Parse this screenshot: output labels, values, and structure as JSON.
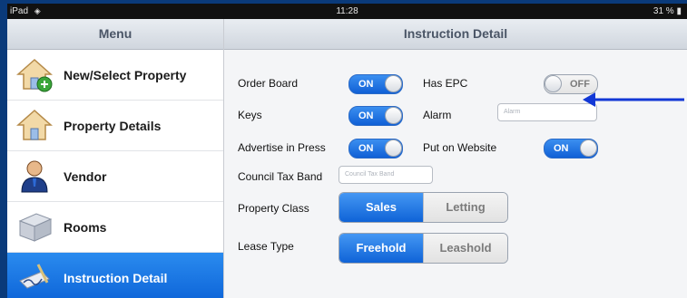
{
  "status_bar": {
    "device": "iPad",
    "time": "11:28",
    "battery": "31 %"
  },
  "sidebar": {
    "title": "Menu",
    "items": [
      {
        "label": "New/Select Property",
        "icon": "house-add-icon"
      },
      {
        "label": "Property Details",
        "icon": "house-icon"
      },
      {
        "label": "Vendor",
        "icon": "person-icon"
      },
      {
        "label": "Rooms",
        "icon": "room-icon"
      },
      {
        "label": "Instruction Detail",
        "icon": "signature-icon",
        "active": true
      }
    ]
  },
  "main": {
    "title": "Instruction Detail",
    "order_board": {
      "label": "Order Board",
      "toggle": "ON"
    },
    "has_epc": {
      "label": "Has EPC",
      "toggle": "OFF"
    },
    "keys": {
      "label": "Keys",
      "toggle": "ON"
    },
    "alarm": {
      "label": "Alarm",
      "placeholder": "Alarm"
    },
    "advertise": {
      "label": "Advertise in Press",
      "toggle": "ON"
    },
    "website": {
      "label": "Put on Website",
      "toggle": "ON"
    },
    "council_tax": {
      "label": "Council Tax Band",
      "placeholder": "Council Tax Band"
    },
    "property_class": {
      "label": "Property Class",
      "options": [
        "Sales",
        "Letting"
      ],
      "selected": "Sales"
    },
    "lease_type": {
      "label": "Lease Type",
      "options": [
        "Freehold",
        "Leashold"
      ],
      "selected": "Freehold"
    }
  },
  "colors": {
    "accent": "#0d64d8",
    "arrow": "#1238d6",
    "background": "#0a3a7a"
  }
}
